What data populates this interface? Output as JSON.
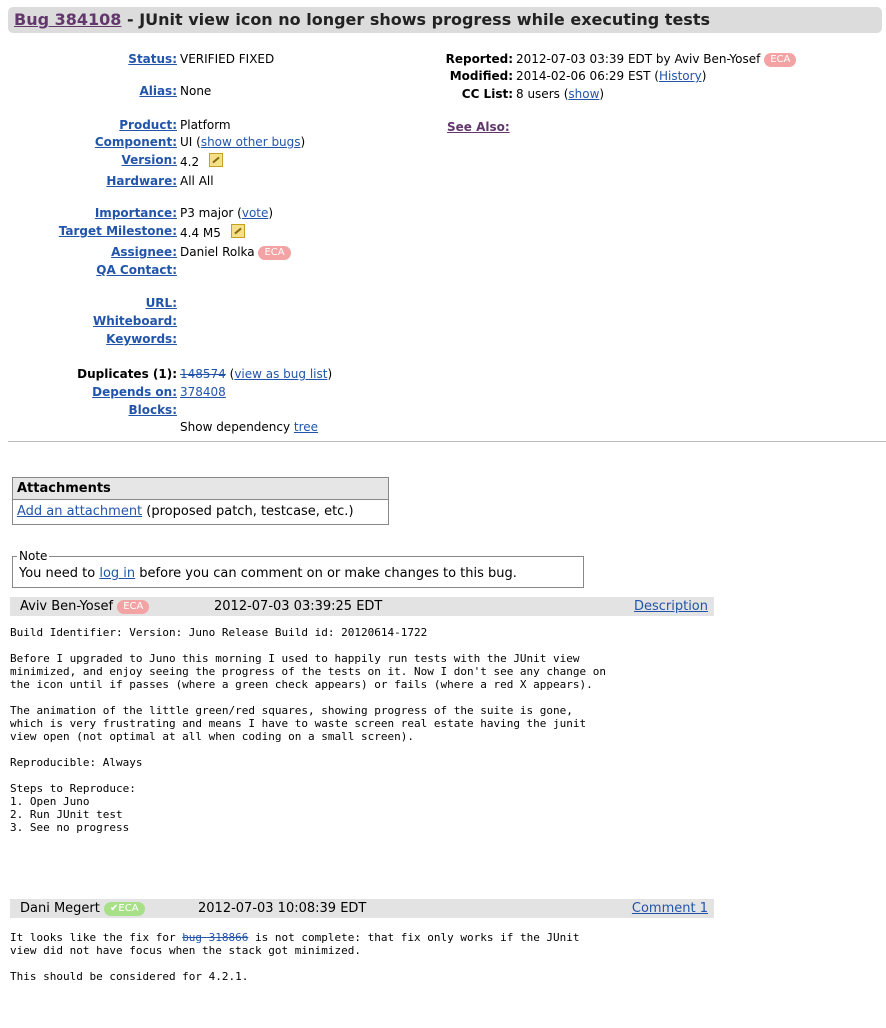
{
  "bug": {
    "link": "Bug 384108",
    "title": " - JUnit view icon no longer shows progress while executing tests"
  },
  "fields": {
    "status_label": "Status:",
    "status_value": "VERIFIED FIXED",
    "alias_label": "Alias:",
    "alias_value": "None",
    "product_label": "Product:",
    "product_value": "Platform",
    "component_label": "Component:",
    "component_value": "UI (",
    "component_link": "show other bugs",
    "component_close": ")",
    "version_label": "Version:",
    "version_value": "4.2",
    "hardware_label": "Hardware:",
    "hardware_value": "All All",
    "importance_label": "Importance:",
    "importance_value": "P3 major (",
    "importance_link": "vote",
    "importance_close": ")",
    "milestone_label": "Target Milestone:",
    "milestone_value": "4.4 M5",
    "assignee_label": "Assignee:",
    "assignee_value": "Daniel Rolka",
    "assignee_badge": "ECA",
    "qa_label": "QA Contact:",
    "url_label": "URL:",
    "whiteboard_label": "Whiteboard:",
    "keywords_label": "Keywords:",
    "duplicates_label": "Duplicates (1):",
    "duplicates_value": "148574",
    "duplicates_link": "view as bug list",
    "depends_label": "Depends on:",
    "depends_value": "378408",
    "blocks_label": "Blocks:",
    "dep_tree_text": "Show dependency ",
    "dep_tree_link": "tree"
  },
  "right_fields": {
    "reported_label": "Reported:",
    "reported_value": "2012-07-03 03:39 EDT by Aviv Ben-Yosef",
    "reported_badge": "ECA",
    "modified_label": "Modified:",
    "modified_value": "2014-02-06 06:29 EST (",
    "history_link": "History",
    "modified_close": ")",
    "cc_label": "CC List:",
    "cc_value": "8 users (",
    "cc_link": "show",
    "cc_close": ")",
    "see_also_label": "See Also:"
  },
  "attachments": {
    "header": "Attachments",
    "add_link": "Add an attachment",
    "add_hint": " (proposed patch, testcase, etc.)"
  },
  "note": {
    "legend": "Note",
    "before": "You need to ",
    "login_link": "log in",
    "after": " before you can comment on or make changes to this bug."
  },
  "comments": [
    {
      "author": "Aviv Ben-Yosef",
      "badge": "ECA",
      "time": "2012-07-03 03:39:25 EDT",
      "link": "Description",
      "text": "Build Identifier: Version: Juno Release Build id: 20120614-1722\n\nBefore I upgraded to Juno this morning I used to happily run tests with the JUnit view\nminimized, and enjoy seeing the progress of the tests on it. Now I don't see any change on\nthe icon until if passes (where a green check appears) or fails (where a red X appears).\n\nThe animation of the little green/red squares, showing progress of the suite is gone,\nwhich is very frustrating and means I have to waste screen real estate having the junit\nview open (not optimal at all when coding on a small screen).\n\nReproducible: Always\n\nSteps to Reproduce:\n1. Open Juno\n2. Run JUnit test\n3. See no progress"
    },
    {
      "author": "Dani Megert",
      "badge": "ECA",
      "time": "2012-07-03 10:08:39 EDT",
      "link": "Comment 1",
      "text_before": "It looks like the fix for ",
      "bug_link": "bug 318866",
      "text_after": " is not complete: that fix only works if the JUnit\nview did not have focus when the stack got minimized.\n\nThis should be considered for 4.2.1."
    }
  ]
}
